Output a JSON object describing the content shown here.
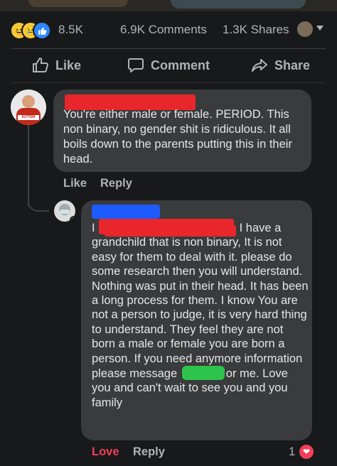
{
  "post_stats": {
    "reaction_icons": [
      "haha-emoji-icon",
      "sad-emoji-icon",
      "like-icon"
    ],
    "reactions_count": "8.5K",
    "comments_count": "6.9K Comments",
    "shares_count": "1.3K Shares"
  },
  "actions": {
    "like": "Like",
    "comment": "Comment",
    "share": "Share"
  },
  "comment1": {
    "text": "You're either male or female. PERIOD. This non binary, no gender shit is ridiculous. It all boils down to the parents putting this in their head.",
    "avatar_badge": "AUTISM",
    "like_label": "Like",
    "reply_label": "Reply"
  },
  "comment2": {
    "text_line1_prefix": "I",
    "text_line1_suffix": "I have a",
    "text_part_a": "grandchild that is non binary, It is not easy for them to deal with it. please do some research then you will understand.   Nothing was put in their head. It has been a long process for them. I  know You are not a person to judge, it is very hard thing to understand. They feel they are not born a male or female you are born a person. If you need anymore information please message",
    "text_part_b": "or me.  Love you and can't wait to see you and you family",
    "love_label": "Love",
    "reply_label": "Reply",
    "reaction_count": "1"
  },
  "colors": {
    "background": "#18191a",
    "bubble": "#3a3b3c",
    "love": "#f33e58",
    "like_blue": "#2d88ff",
    "redaction_red": "#e8262b",
    "redaction_blue": "#1e5bff",
    "redaction_green": "#2ec34c"
  }
}
